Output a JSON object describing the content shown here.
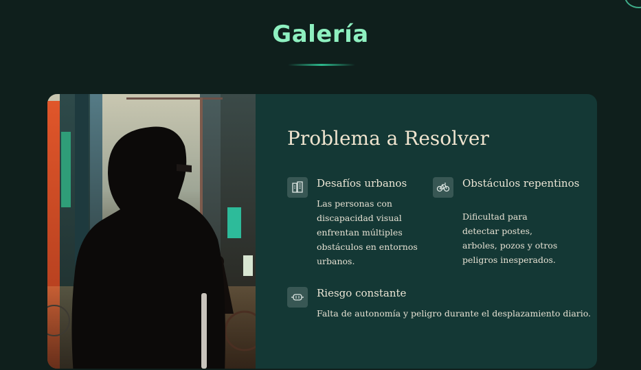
{
  "section": {
    "title": "Galería"
  },
  "card": {
    "heading": "Problema a Resolver",
    "features": [
      {
        "icon": "building-icon",
        "title": "Desafíos urbanos",
        "description": "Las personas con discapacidad visual enfrentan múltiples obstáculos en entornos urbanos."
      },
      {
        "icon": "bicycle-icon",
        "title": "Obstáculos repentinos",
        "description": "Dificultad para detectar postes, arboles, pozos y otros peligros inesperados."
      },
      {
        "icon": "warning-icon",
        "title": "Riesgo constante",
        "description": "Falta de autonomía y peligro durante el desplazamiento diario."
      }
    ]
  },
  "colors": {
    "background": "#0f1f1c",
    "accent": "#8ef0c0",
    "card": "#143835",
    "icon_box": "#385754"
  }
}
